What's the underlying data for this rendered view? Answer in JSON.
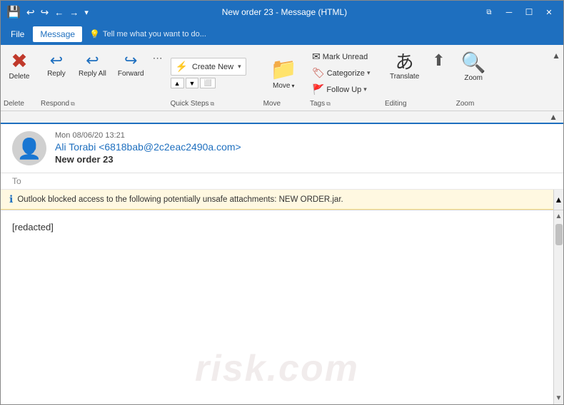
{
  "window": {
    "title": "New order 23 - Message (HTML)",
    "save_icon": "💾",
    "undo_icon": "↩",
    "redo_icon": "↪",
    "back_icon": "←",
    "forward_icon": "→",
    "more_icon": "▾",
    "min_btn": "─",
    "restore_btn": "❐",
    "close_btn": "✕"
  },
  "menu": {
    "file_label": "File",
    "message_label": "Message",
    "tell_me_label": "Tell me what you want to do...",
    "tell_me_icon": "💡"
  },
  "ribbon": {
    "delete_btn": "✖",
    "delete_label": "Delete",
    "reply_icon": "↩",
    "reply_label": "Reply",
    "reply_all_icon": "↩↩",
    "reply_all_label": "Reply All",
    "forward_icon": "→",
    "forward_label": "Forward",
    "more_btn_label": "⋯",
    "respond_label": "Respond",
    "quicksteps_label": "Quick Steps",
    "create_new_icon": "⚡",
    "create_new_label": "Create New",
    "qs_dropdown": "▾",
    "move_icon": "📁",
    "move_label": "Move",
    "move_group_label": "Move",
    "mark_unread_icon": "✉",
    "mark_unread_label": "Mark Unread",
    "categorize_icon": "🏷",
    "categorize_label": "Categorize",
    "categorize_dropdown": "▾",
    "followup_icon": "🚩",
    "followup_label": "Follow Up",
    "followup_dropdown": "▾",
    "tags_label": "Tags",
    "translate_icon": "あ",
    "translate_label": "Translate",
    "editing_label": "Editing",
    "cursor_icon": "⬆",
    "zoom_icon": "🔍",
    "zoom_label": "Zoom",
    "zoom_group_label": "Zoom"
  },
  "ribbon_tabs": {
    "delete_tab": "Delete",
    "respond_tab": "Respond",
    "quicksteps_tab": "Quick Steps",
    "move_tab": "Move",
    "tags_tab": "Tags",
    "editing_tab": "Editing",
    "zoom_tab": "Zoom"
  },
  "email": {
    "date": "Mon 08/06/20 13:21",
    "from": "Ali Torabi <6818bab@2c2eac2490a.com>",
    "subject": "New order 23",
    "to_label": "To",
    "warning": "Outlook blocked access to the following potentially unsafe attachments: NEW ORDER.jar.",
    "body": "[redacted]",
    "watermark": "risk.com"
  }
}
